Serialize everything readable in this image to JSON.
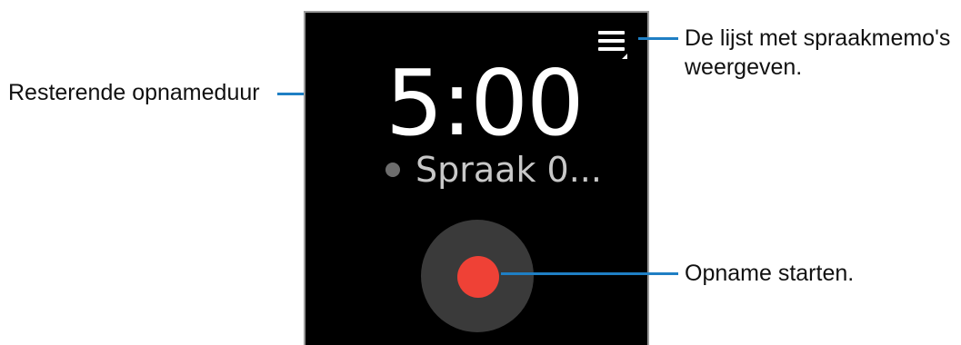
{
  "screen": {
    "timer": "5:00",
    "file_name": "Spraak 0..."
  },
  "annotations": {
    "remaining_time": "Resterende opnameduur",
    "list_line1": "De lijst met spraakmemo's",
    "list_line2": "weergeven.",
    "start_recording": "Opname starten."
  },
  "colors": {
    "screen_background": "#000000",
    "record_button": "#3a3a3a",
    "record_dot": "#ef4136",
    "callout_line": "#1f7fc4"
  },
  "icons": {
    "menu": "list-menu-icon",
    "record": "record-icon",
    "status": "status-dot-icon"
  }
}
